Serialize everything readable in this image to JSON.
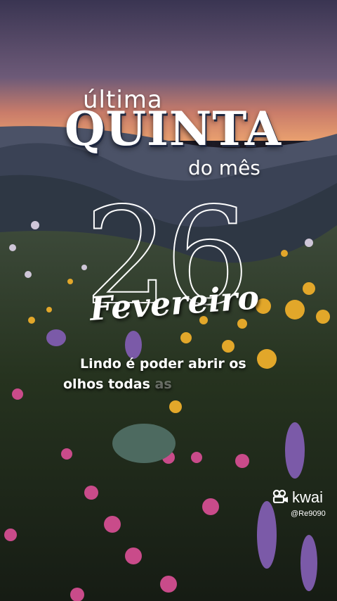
{
  "header": {
    "top_line": "última",
    "main_word": "QUINTA",
    "bottom_line": "do mês"
  },
  "date": {
    "day": "26",
    "month": "Fevereiro"
  },
  "caption": {
    "line1": "Lindo é poder abrir os",
    "line2_visible": "olhos todas",
    "line2_faded": " as"
  },
  "watermark": {
    "brand": "kwai",
    "handle": "@Re9090",
    "icon": "kwai-camera-icon"
  },
  "colors": {
    "sky_top": "#3a3552",
    "sky_glow": "#e08a5a",
    "hills": "#2c3646",
    "foliage": "#24331f"
  }
}
